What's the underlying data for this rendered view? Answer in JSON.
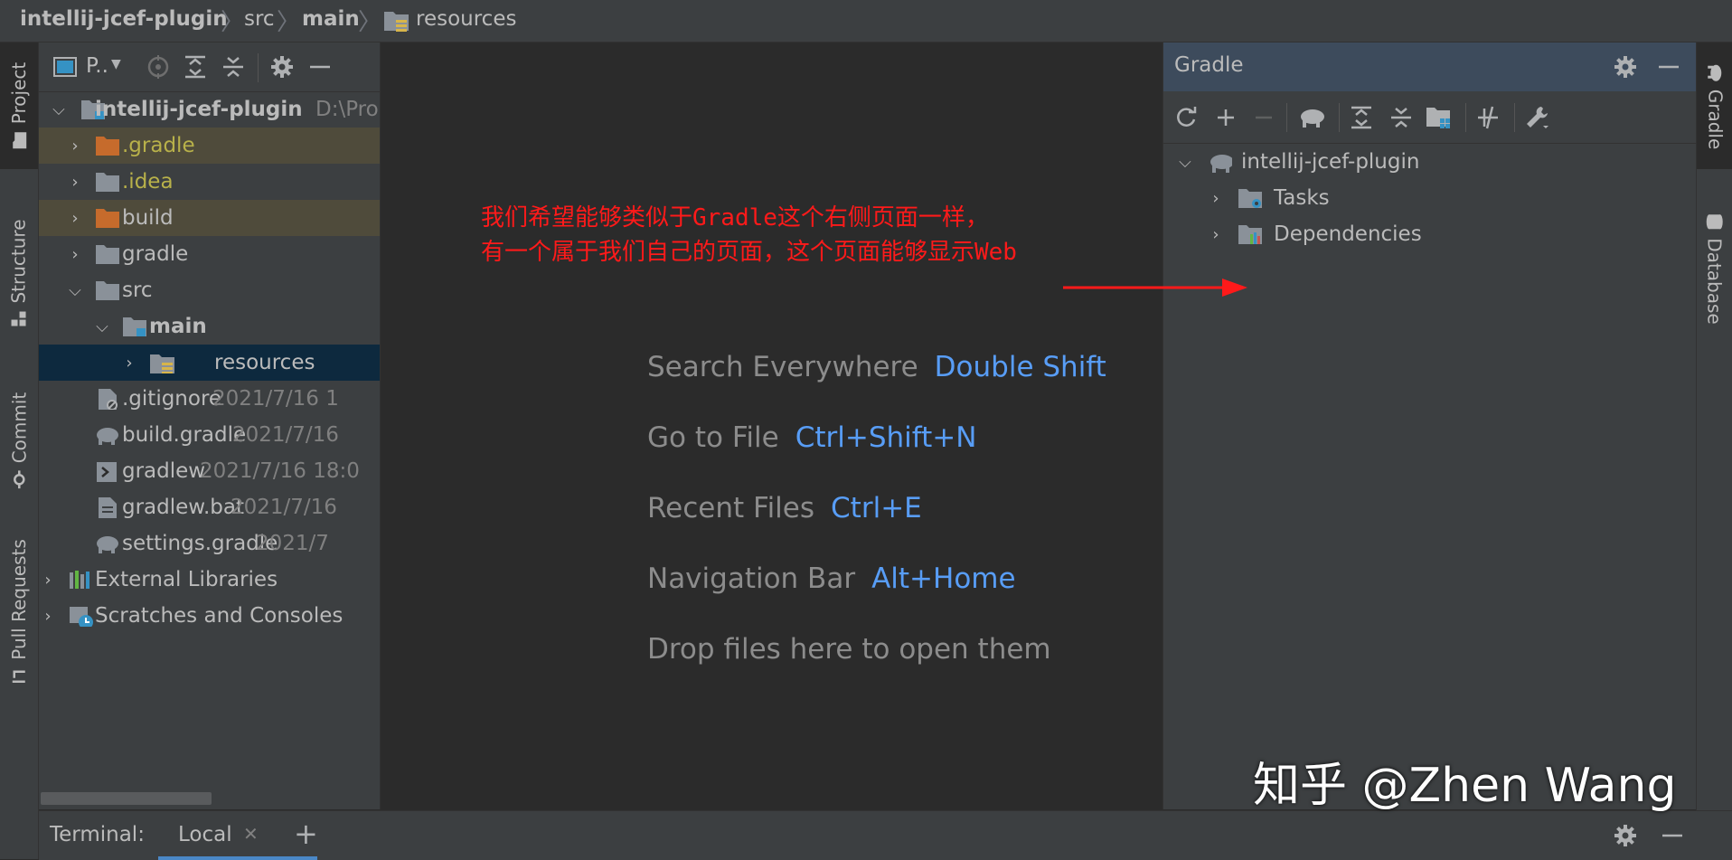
{
  "breadcrumb": {
    "items": [
      "intellij-jcef-plugin",
      "src",
      "main",
      "resources"
    ]
  },
  "left_tool_tabs": [
    "Project",
    "Structure",
    "Commit",
    "Pull Requests"
  ],
  "right_tool_tabs": [
    "Gradle",
    "Database"
  ],
  "project_panel": {
    "view_selector": "P..",
    "tree": [
      {
        "label": "intellij-jcef-plugin",
        "meta": "D:\\Pro"
      },
      {
        "label": ".gradle",
        "meta": ""
      },
      {
        "label": ".idea",
        "meta": ""
      },
      {
        "label": "build",
        "meta": ""
      },
      {
        "label": "gradle",
        "meta": ""
      },
      {
        "label": "src",
        "meta": ""
      },
      {
        "label": "main",
        "meta": ""
      },
      {
        "label": "resources",
        "meta": ""
      },
      {
        "label": ".gitignore",
        "meta": "2021/7/16 1"
      },
      {
        "label": "build.gradle",
        "meta": "2021/7/16"
      },
      {
        "label": "gradlew",
        "meta": "2021/7/16 18:0"
      },
      {
        "label": "gradlew.bat",
        "meta": "2021/7/16"
      },
      {
        "label": "settings.gradle",
        "meta": "2021/7"
      },
      {
        "label": "External Libraries",
        "meta": ""
      },
      {
        "label": "Scratches and Consoles",
        "meta": ""
      }
    ]
  },
  "editor_hints": [
    {
      "action": "Search Everywhere",
      "shortcut": "Double Shift"
    },
    {
      "action": "Go to File",
      "shortcut": "Ctrl+Shift+N"
    },
    {
      "action": "Recent Files",
      "shortcut": "Ctrl+E"
    },
    {
      "action": "Navigation Bar",
      "shortcut": "Alt+Home"
    },
    {
      "action": "Drop files here to open them",
      "shortcut": ""
    }
  ],
  "gradle_panel": {
    "title": "Gradle",
    "tree": [
      {
        "label": "intellij-jcef-plugin"
      },
      {
        "label": "Tasks"
      },
      {
        "label": "Dependencies"
      }
    ]
  },
  "annotation": {
    "line1": "我们希望能够类似于Gradle这个右侧页面一样，",
    "line2": "有一个属于我们自己的页面，这个页面能够显示Web",
    "color": "#ff1a1a"
  },
  "bottom_bar": {
    "terminal_label": "Terminal:",
    "tab_local": "Local"
  },
  "watermark": "知乎 @Zhen Wang",
  "colors": {
    "accent_link": "#589df6",
    "selection": "#0d293e",
    "excluded_highlight": "#4f4b3b",
    "excluded_folder": "#c66b2c"
  }
}
